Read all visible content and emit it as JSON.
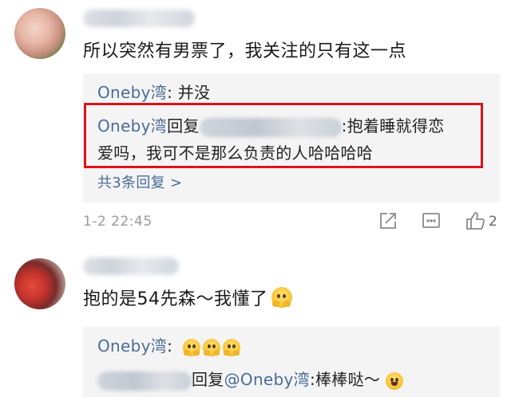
{
  "comments": [
    {
      "body": "所以突然有男票了，我关注的只有这一点",
      "replies": {
        "first_author": "Oneby湾",
        "first_text": ": 并没",
        "second_author": "Oneby湾",
        "second_reply_word": "回复",
        "second_text_line1": ":抱着睡就得恋",
        "second_text_line2": "爱吗，我可不是那么负责的人哈哈哈哈",
        "more_label": "共3条回复 >"
      },
      "time": "1-2 22:45",
      "actions": {
        "share_icon": "share-icon",
        "comment_icon": "comment-icon",
        "like_icon": "thumbs-up-icon",
        "like_count": "2"
      }
    },
    {
      "body": "抱的是54先森～我懂了",
      "replies": {
        "first_author": "Oneby湾",
        "first_text": ":",
        "second_reply_prefix": "回复",
        "second_mention": "@Oneby湾",
        "second_text": ":棒棒哒～"
      }
    }
  ],
  "colors": {
    "link": "#4a6d96",
    "highlight_border": "#e0121b",
    "reply_bg": "#f4f4f5"
  }
}
